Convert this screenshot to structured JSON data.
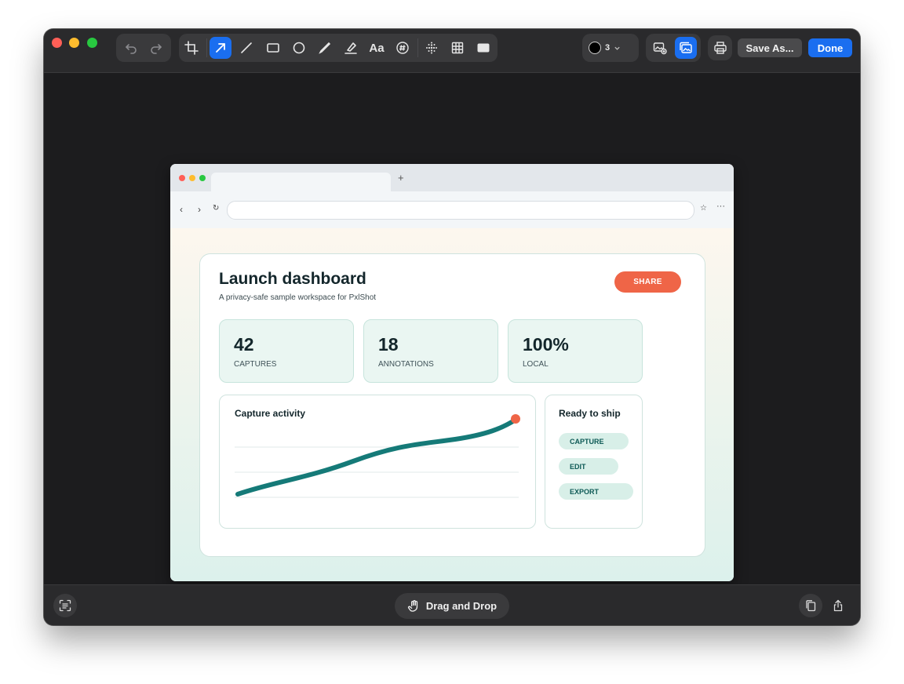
{
  "toolbar": {
    "stroke_size": "3",
    "stroke_color": "#000000",
    "accent": "#1a6ef0",
    "save_as_label": "Save As...",
    "done_label": "Done",
    "text_tool_label": "Aa",
    "tools": [
      "undo-icon",
      "redo-icon",
      "crop-icon",
      "arrow-icon",
      "line-icon",
      "rectangle-icon",
      "ellipse-icon",
      "pen-icon",
      "highlighter-icon",
      "text-icon",
      "counter-icon",
      "blur-icon",
      "pixelate-icon",
      "fill-icon"
    ],
    "active_tool": "arrow-icon"
  },
  "dashboard": {
    "title": "Launch dashboard",
    "subtitle": "A privacy-safe sample workspace for PxlShot",
    "share_label": "SHARE",
    "stats": [
      {
        "value": "42",
        "label": "CAPTURES"
      },
      {
        "value": "18",
        "label": "ANNOTATIONS"
      },
      {
        "value": "100%",
        "label": "LOCAL"
      }
    ],
    "chart_title": "Capture activity",
    "ship_title": "Ready to ship",
    "ship_items": [
      "CAPTURE",
      "EDIT",
      "EXPORT"
    ]
  },
  "bottom": {
    "drag_label": "Drag and Drop"
  },
  "colors": {
    "share": "#ef6547",
    "chart_line": "#157a78",
    "chart_endpoint": "#ef6547"
  }
}
